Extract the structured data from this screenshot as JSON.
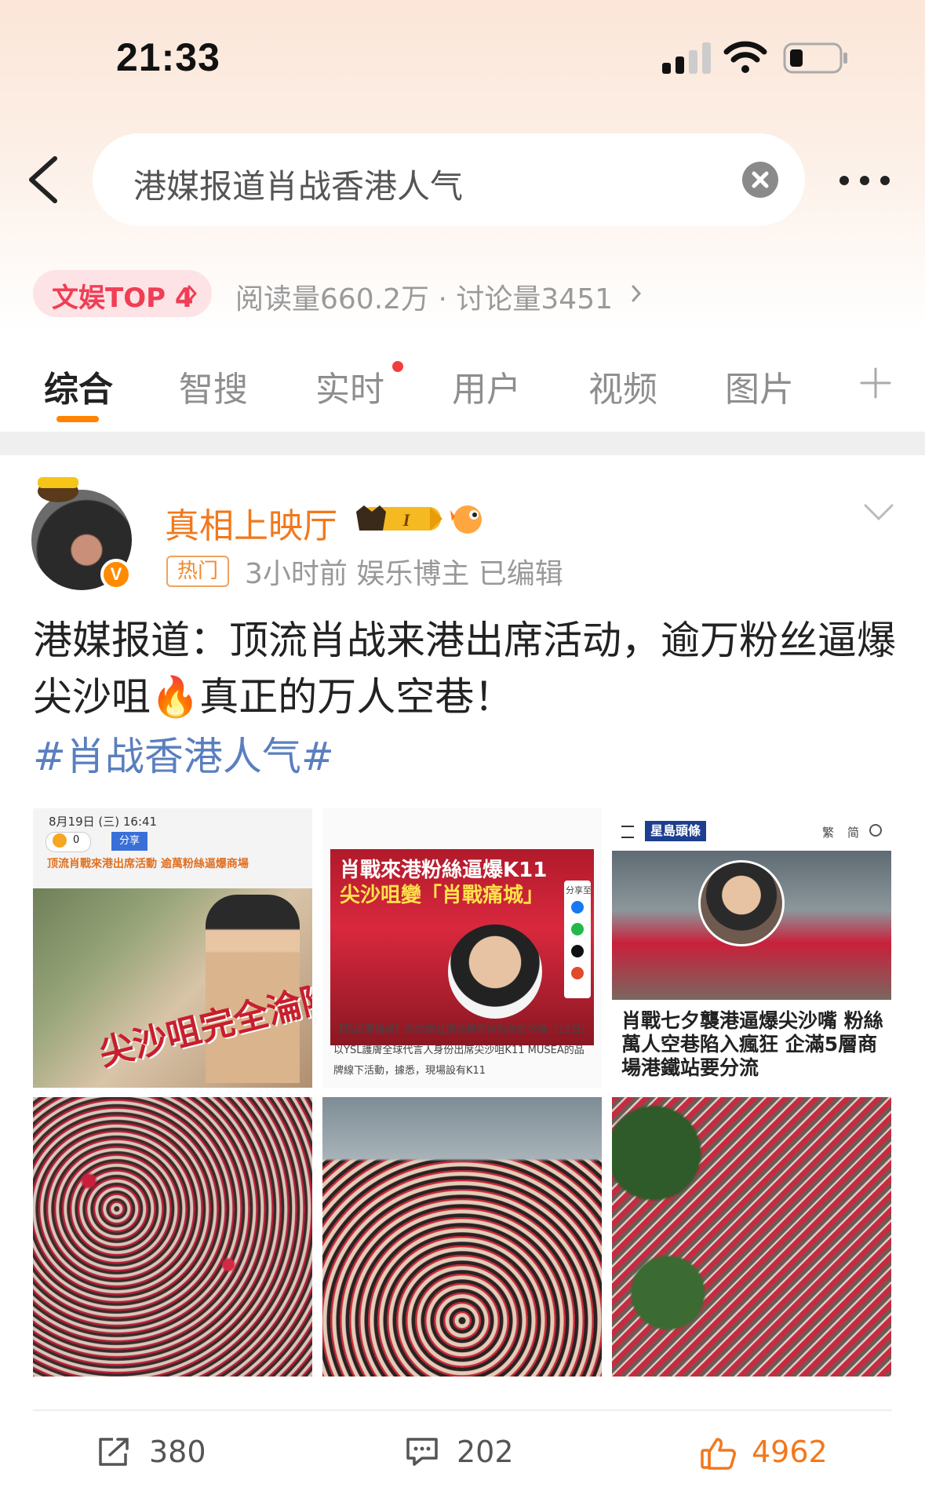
{
  "status_bar": {
    "time": "21:33"
  },
  "search": {
    "query": "港媒报道肖战香港人气"
  },
  "hot_rank": {
    "badge": "文娱TOP 4",
    "stats": "阅读量660.2万 · 讨论量3451"
  },
  "tabs": [
    {
      "label": "综合"
    },
    {
      "label": "智搜"
    },
    {
      "label": "实时"
    },
    {
      "label": "用户"
    },
    {
      "label": "视频"
    },
    {
      "label": "图片"
    }
  ],
  "post": {
    "author": "真相上映厅",
    "member_level": "I",
    "tag": "热门",
    "meta": "3小时前  娱乐博主  已编辑",
    "text_part1": "港媒报道：顶流肖战来港出席活动，逾万粉丝逼爆尖沙咀",
    "text_part2": "真正的万人空巷！",
    "hashtag": "#肖战香港人气#",
    "images": {
      "img1": {
        "date": "8月19日 (三) 16:41",
        "count": "0",
        "share": "分享",
        "headline": "顶流肖戰來港出席活動  逾萬粉絲逼爆商場",
        "overlay": "尖沙咀完全淪陷"
      },
      "img2": {
        "banner": "肖戰來港粉絲逼爆K11",
        "banner2": "尖沙咀變「肖戰痛城」",
        "share_to": "分享至",
        "caption": "【點新聞報道】內地當紅頂流男星肖戰將於今晚（19日）以YSL護膚全球代言人身份出席尖沙咀K11 MUSEA的品牌線下活動，據悉，現場設有K11"
      },
      "img3": {
        "brand": "星島頭條",
        "lang_trad": "繁",
        "lang_simp": "简",
        "headline": "肖戰七夕襲港逼爆尖沙嘴 粉絲萬人空巷陷入瘋狂 企滿5層商場港鐵站要分流"
      }
    },
    "actions": {
      "reposts": "380",
      "comments": "202",
      "likes": "4962"
    }
  },
  "colors": {
    "accent_orange": "#ff8200",
    "username_orange": "#f2781c",
    "hashtag_blue": "#5a7fbf",
    "rank_red": "#ef3e55"
  }
}
